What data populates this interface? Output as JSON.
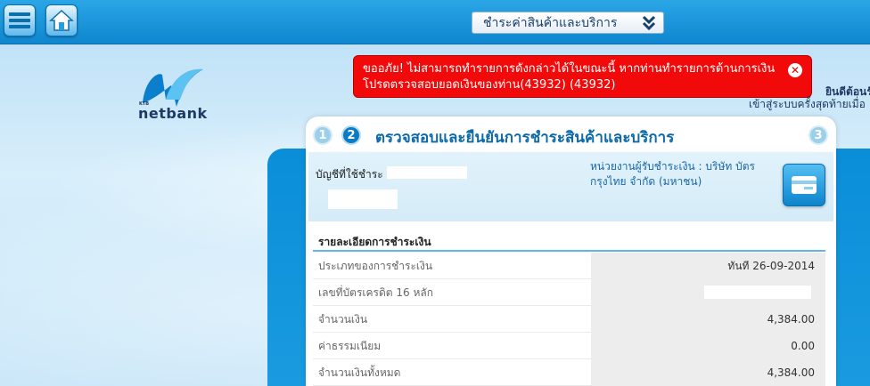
{
  "header": {
    "service_dropdown": "ชำระค่าสินค้าและบริการ"
  },
  "brand": {
    "logo_small": "KTB",
    "logo_text": "netbank"
  },
  "error": {
    "line1": "ขออภัย! ไม่สามารถทำรายการดังกล่าวได้ในขณะนี้ หากท่านทำรายการด้านการเงิน",
    "line2": "โปรดตรวจสอบยอดเงินของท่าน(43932) (43932)"
  },
  "session": {
    "welcome": "ยินดีต้อนรับ",
    "last_login": "เข้าสู่ระบบครั้งสุดท้ายเมื่อ"
  },
  "steps": [
    "1",
    "2",
    "3"
  ],
  "card": {
    "title": "ตรวจสอบและยืนยันการชำระสินค้าและบริการ",
    "account_label": "บัญชีที่ใช้ชำระ :",
    "payee_line1": "หน่วยงานผู้รับชำระเงิน : บริษัท บัตร",
    "payee_line2": "กรุงไทย จำกัด (มหาชน)"
  },
  "details": {
    "title": "รายละเอียดการชำระเงิน",
    "rows": [
      {
        "label": "ประเภทของการชำระเงิน",
        "value": "ทันที 26-09-2014"
      },
      {
        "label": "เลขที่บัตรเครดิต 16 หลัก",
        "value": ""
      },
      {
        "label": "จำนวนเงิน",
        "value": "4,384.00"
      },
      {
        "label": "ค่าธรรมเนียม",
        "value": "0.00"
      },
      {
        "label": "จำนวนเงินทั้งหมด",
        "value": "4,384.00"
      }
    ]
  },
  "colors": {
    "topbar": "#1596d9",
    "error": "#f20a0a",
    "title": "#0d6aa8",
    "accent_line": "#62b6e2"
  }
}
